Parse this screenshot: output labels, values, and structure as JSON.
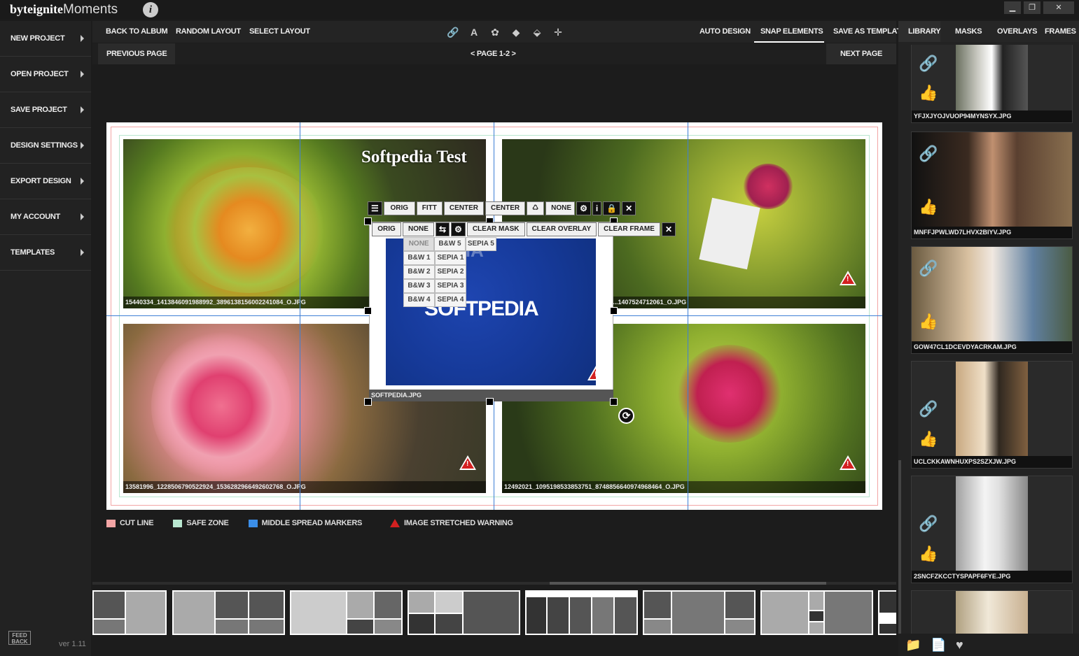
{
  "app": {
    "brand_bold": "byteignite",
    "brand_light": "Moments",
    "version": "ver 1.11",
    "feedback": "FEED BACK",
    "window_controls": [
      "minimize-icon",
      "restore-icon",
      "close-icon"
    ]
  },
  "sidebar": {
    "items": [
      {
        "label": "NEW PROJECT"
      },
      {
        "label": "OPEN PROJECT"
      },
      {
        "label": "SAVE PROJECT"
      },
      {
        "label": "DESIGN SETTINGS"
      },
      {
        "label": "EXPORT DESIGN"
      },
      {
        "label": "MY ACCOUNT"
      },
      {
        "label": "TEMPLATES"
      }
    ]
  },
  "toolbar": {
    "back": "BACK TO ALBUM",
    "random": "RANDOM LAYOUT",
    "select": "SELECT LAYOUT",
    "auto": "AUTO DESIGN",
    "snap": "SNAP ELEMENTS",
    "save_template": "SAVE AS TEMPLATE",
    "icons": [
      "link-icon",
      "text-icon",
      "flower-icon",
      "layer-up-icon",
      "layer-down-icon",
      "crosshair-icon"
    ]
  },
  "nav": {
    "prev": "PREVIOUS PAGE",
    "page": "< PAGE 1-2 >",
    "next": "NEXT PAGE"
  },
  "canvas": {
    "watermark": "Softpedia Test",
    "photos": [
      {
        "label": "15440334_1413846091988992_3896138156002241084_O.JPG"
      },
      {
        "label": "...1407524712061_O.JPG"
      },
      {
        "label": "13581996_1228506790522924_1536282966492602768_O.JPG"
      },
      {
        "label": "12492021_1095198533853751_8748856640974968464_O.JPG"
      }
    ],
    "selected": {
      "label": "SOFTPEDIA.JPG",
      "logo": "SOFTPEDIA",
      "faded_text": "DIA"
    },
    "toolbar_a": [
      "ORIG",
      "FITT",
      "CENTER",
      "CENTER",
      "NONE"
    ],
    "toolbar_b": [
      "ORIG",
      "NONE",
      "CLEAR MASK",
      "CLEAR OVERLAY",
      "CLEAR FRAME"
    ],
    "filters": [
      [
        "NONE",
        "B&W 5",
        "SEPIA 5"
      ],
      [
        "B&W 1",
        "SEPIA 1"
      ],
      [
        "B&W 2",
        "SEPIA 2"
      ],
      [
        "B&W 3",
        "SEPIA 3"
      ],
      [
        "B&W 4",
        "SEPIA 4"
      ]
    ]
  },
  "legend": {
    "cut": "CUT LINE",
    "safe": "SAFE ZONE",
    "middle": "MIDDLE SPREAD MARKERS",
    "warn": "IMAGE STRETCHED WARNING",
    "colors": {
      "cut": "#f3a5a5",
      "safe": "#b8e6cf",
      "middle": "#3b8ee8",
      "warn": "#d32020"
    }
  },
  "right_panel": {
    "tabs": [
      "LIBRARY",
      "MASKS",
      "OVERLAYS",
      "FRAMES"
    ],
    "items": [
      {
        "label": "YFJXJYOJVUOP94MYNSYX.JPG"
      },
      {
        "label": "MNFFJPWLWD7LHVX2BIYV.JPG"
      },
      {
        "label": "GOW47CL1DCEVDYACRKAM.JPG"
      },
      {
        "label": "UCLCKKAWNHUXPS2SZXJW.JPG"
      },
      {
        "label": "2SNCFZKCCTYSPAPF6FYE.JPG"
      }
    ],
    "bottom_icons": [
      "add-folder-icon",
      "add-file-icon",
      "heart-icon"
    ]
  }
}
